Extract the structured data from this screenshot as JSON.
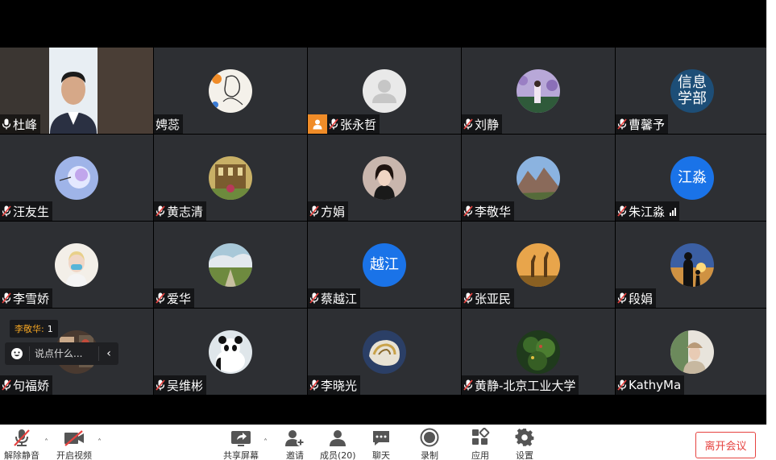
{
  "participants": [
    {
      "name": "杜峰",
      "mic": "on",
      "type": "video"
    },
    {
      "name": "娉蕊",
      "mic": "none",
      "type": "photo",
      "avatar": "sketch"
    },
    {
      "name": "张永哲",
      "mic": "muted",
      "type": "photo",
      "avatar": "default",
      "host": true
    },
    {
      "name": "刘静",
      "mic": "muted",
      "type": "photo",
      "avatar": "flowers"
    },
    {
      "name": "曹馨予",
      "mic": "muted",
      "type": "text",
      "avatar_text": "信息\n学部",
      "avatar_color": "#1d4e77"
    },
    {
      "name": "汪友生",
      "mic": "muted",
      "type": "photo",
      "avatar": "bubble"
    },
    {
      "name": "黄志清",
      "mic": "muted",
      "type": "photo",
      "avatar": "building"
    },
    {
      "name": "方娟",
      "mic": "muted",
      "type": "photo",
      "avatar": "woman"
    },
    {
      "name": "李敬华",
      "mic": "muted",
      "type": "photo",
      "avatar": "mountain"
    },
    {
      "name": "朱江淼",
      "mic": "muted",
      "type": "text",
      "avatar_text": "江淼",
      "avatar_color": "#1a73e8",
      "signal": true
    },
    {
      "name": "李雪娇",
      "mic": "muted",
      "type": "photo",
      "avatar": "girl"
    },
    {
      "name": "爱华",
      "mic": "muted",
      "type": "photo",
      "avatar": "field"
    },
    {
      "name": "蔡越江",
      "mic": "muted",
      "type": "text",
      "avatar_text": "越江",
      "avatar_color": "#1a73e8"
    },
    {
      "name": "张亚民",
      "mic": "muted",
      "type": "photo",
      "avatar": "giraffe"
    },
    {
      "name": "段娟",
      "mic": "muted",
      "type": "photo",
      "avatar": "sunset"
    },
    {
      "name": "句福娇",
      "mic": "muted",
      "type": "photo",
      "avatar": "room"
    },
    {
      "name": "吴维彬",
      "mic": "muted",
      "type": "photo",
      "avatar": "panda"
    },
    {
      "name": "李晓光",
      "mic": "muted",
      "type": "photo",
      "avatar": "shell"
    },
    {
      "name": "黄静-北京工业大学",
      "mic": "muted",
      "type": "photo",
      "avatar": "tree"
    },
    {
      "name": "KathyMa",
      "mic": "muted",
      "type": "photo",
      "avatar": "lady"
    }
  ],
  "chat": {
    "last_sender": "李敬华:",
    "last_message": "1",
    "placeholder": "说点什么...",
    "collapse_icon": "chevron-left"
  },
  "toolbar": {
    "unmute": "解除静音",
    "start_video": "开启视频",
    "share_screen": "共享屏幕",
    "invite": "邀请",
    "members": "成员(20)",
    "chat": "聊天",
    "record": "录制",
    "apps": "应用",
    "settings": "设置",
    "leave": "离开会议"
  },
  "colors": {
    "tile_bg": "#2d2f33",
    "leave_red": "#e64340",
    "host_orange": "#f08c28",
    "text_avatar_blue": "#1a73e8"
  }
}
